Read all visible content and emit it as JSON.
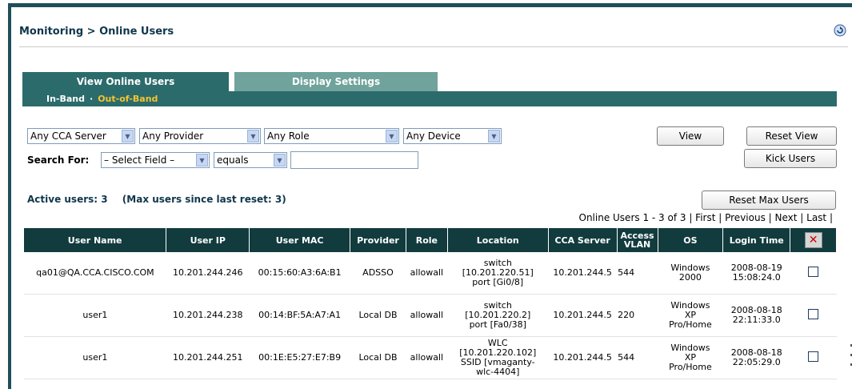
{
  "breadcrumb": "Monitoring > Online Users",
  "tabs": {
    "active": "View Online Users",
    "inactive": "Display Settings"
  },
  "subtabs": {
    "inband": "In-Band",
    "separator": "·",
    "outofband": "Out-of-Band"
  },
  "filters": {
    "cca_server": "Any CCA Server",
    "provider": "Any Provider",
    "role": "Any Role",
    "device": "Any Device",
    "search_label": "Search For:",
    "search_field": "– Select Field –",
    "operator": "equals",
    "search_value": ""
  },
  "buttons": {
    "view": "View",
    "reset_view": "Reset View",
    "kick_users": "Kick Users",
    "reset_max": "Reset Max Users"
  },
  "summary": {
    "active": "Active users: 3",
    "max": "(Max users since last reset: 3)"
  },
  "pager": {
    "range": "Online Users 1 - 3 of 3",
    "first": "First",
    "previous": "Previous",
    "next": "Next",
    "last": "Last"
  },
  "table": {
    "headers": [
      "User Name",
      "User IP",
      "User MAC",
      "Provider",
      "Role",
      "Location",
      "CCA Server",
      "Access VLAN",
      "OS",
      "Login Time"
    ],
    "rows": [
      {
        "name": "qa01@QA.CCA.CISCO.COM",
        "ip": "10.201.244.246",
        "mac": "00:15:60:A3:6A:B1",
        "provider": "ADSSO",
        "role": "allowall",
        "location": [
          "switch",
          "[10.201.220.51]",
          "port [Gi0/8]"
        ],
        "cca_server": "10.201.244.5",
        "vlan": "544",
        "os": [
          "Windows",
          "2000"
        ],
        "login": [
          "2008-08-19",
          "15:08:24.0"
        ]
      },
      {
        "name": "user1",
        "ip": "10.201.244.238",
        "mac": "00:14:BF:5A:A7:A1",
        "provider": "Local DB",
        "role": "allowall",
        "location": [
          "switch",
          "[10.201.220.2]",
          "port [Fa0/38]"
        ],
        "cca_server": "10.201.244.5",
        "vlan": "220",
        "os": [
          "Windows",
          "XP",
          "Pro/Home"
        ],
        "login": [
          "2008-08-18",
          "22:11:33.0"
        ]
      },
      {
        "name": "user1",
        "ip": "10.201.244.251",
        "mac": "00:1E:E5:27:E7:B9",
        "provider": "Local DB",
        "role": "allowall",
        "location": [
          "WLC",
          "[10.201.220.102]",
          "SSID [vmaganty-",
          "wlc-4404]"
        ],
        "cca_server": "10.201.244.5",
        "vlan": "544",
        "os": [
          "Windows",
          "XP",
          "Pro/Home"
        ],
        "login": [
          "2008-08-18",
          "22:05:29.0"
        ]
      }
    ]
  },
  "colors": {
    "header_bg": "#123b3e",
    "tab_active": "#2c6b6b",
    "tab_inactive": "#6fa39c",
    "out_of_band": "#f4c430"
  }
}
